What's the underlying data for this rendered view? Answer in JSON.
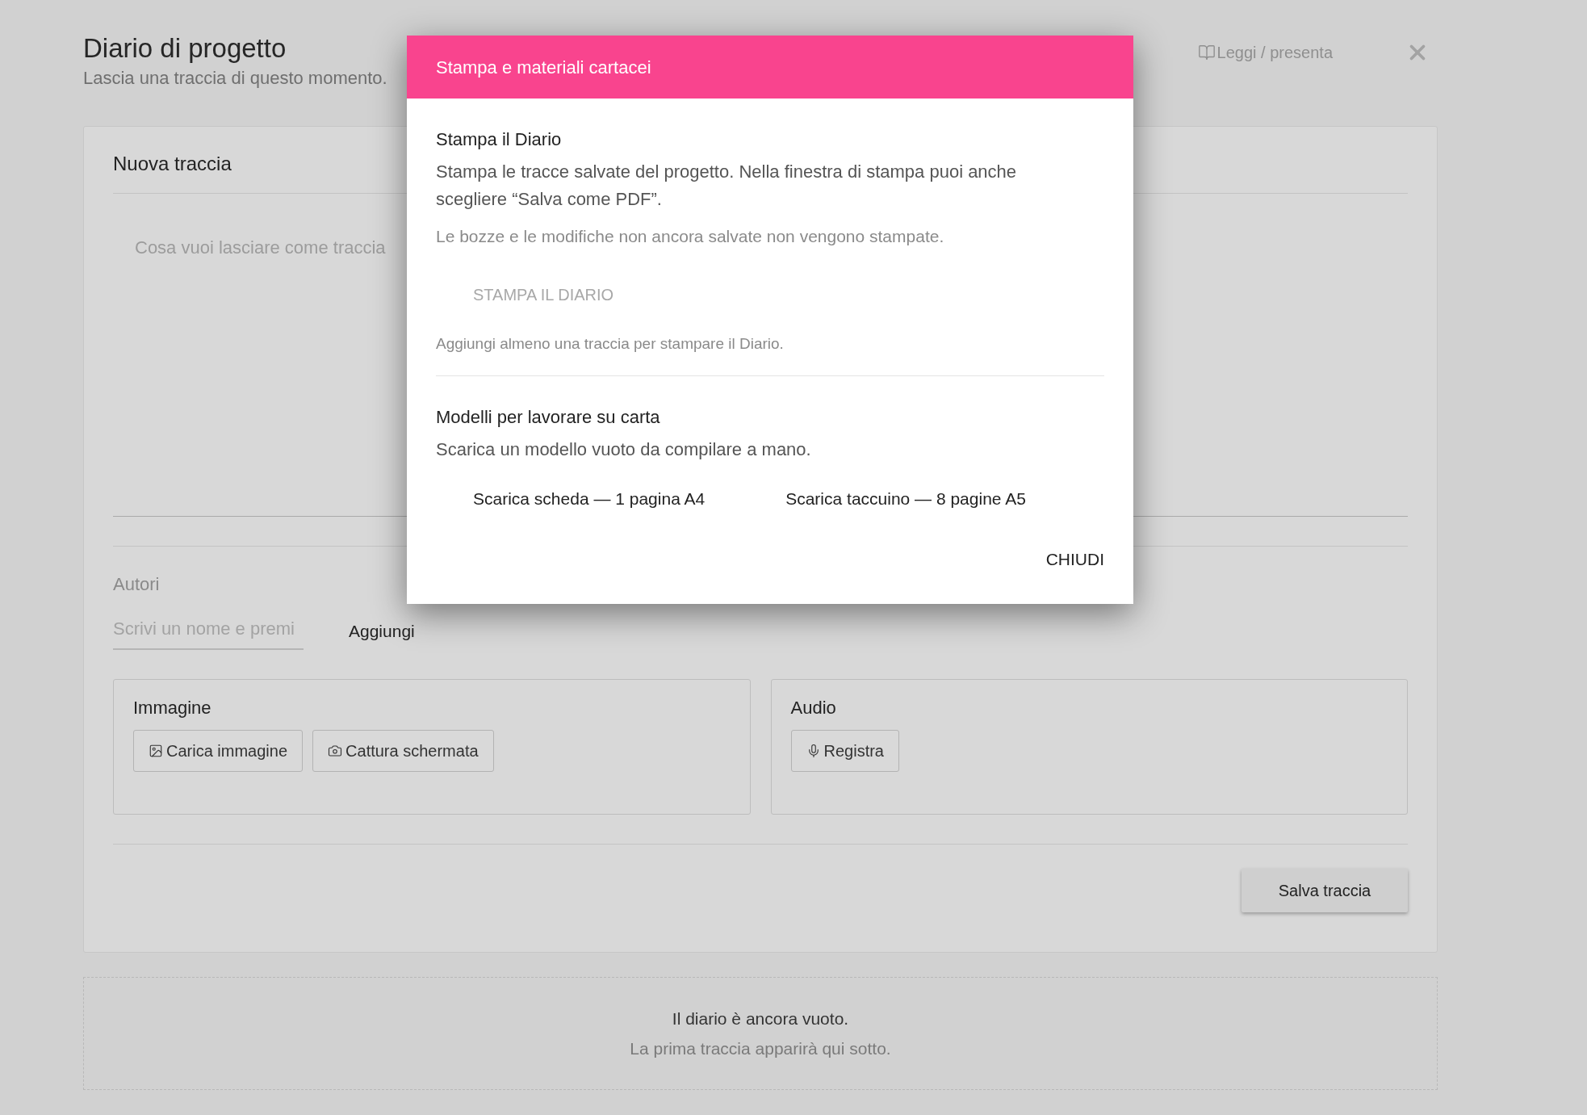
{
  "header": {
    "title": "Diario di progetto",
    "subtitle": "Lascia una traccia di questo momento.",
    "read_link": "Leggi / presenta"
  },
  "new_entry": {
    "title": "Nuova traccia",
    "text_placeholder": "Cosa vuoi lasciare come traccia",
    "authors": {
      "label": "Autori",
      "placeholder": "Scrivi un nome e premi",
      "add_button": "Aggiungi"
    },
    "attachments": [
      {
        "title": "Immagine",
        "buttons": [
          {
            "kind": "upload",
            "label": "Carica immagine"
          },
          {
            "kind": "screenshot",
            "label": "Cattura schermata"
          }
        ]
      },
      {
        "title": "Audio",
        "buttons": [
          {
            "kind": "record",
            "label": "Registra"
          }
        ]
      }
    ],
    "save_button": "Salva traccia"
  },
  "empty_state": {
    "title": "Il diario è ancora vuoto.",
    "text": "La prima traccia apparirà qui sotto."
  },
  "dialog": {
    "title": "Stampa e materiali cartacei",
    "print": {
      "heading": "Stampa il Diario",
      "text": "Stampa le tracce salvate del progetto. Nella finestra di stampa puoi anche scegliere “Salva come PDF”.",
      "note": "Le bozze e le modifiche non ancora salvate non vengono stampate.",
      "button": {
        "label": "STAMPA IL DIARIO",
        "disabled": true
      },
      "hint": "Aggiungi almeno una traccia per stampare il Diario."
    },
    "templates": {
      "heading": "Modelli per lavorare su carta",
      "text": "Scarica un modello vuoto da compilare a mano.",
      "links": [
        "Scarica scheda — 1 pagina A4",
        "Scarica taccuino — 8 pagine A5"
      ]
    },
    "close_button": "CHIUDI"
  }
}
